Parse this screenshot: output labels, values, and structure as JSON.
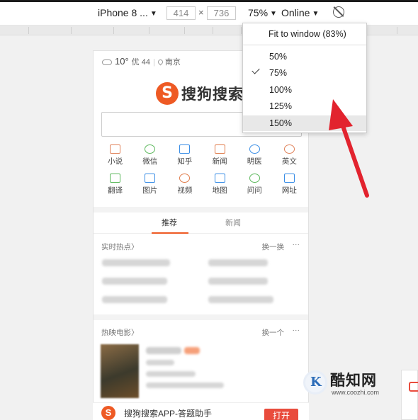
{
  "toolbar": {
    "device": "iPhone 8 ...",
    "width": "414",
    "times": "×",
    "height": "736",
    "zoom": "75%",
    "network": "Online"
  },
  "zoom_menu": {
    "fit_label": "Fit to window (83%)",
    "options": [
      "50%",
      "75%",
      "100%",
      "125%",
      "150%"
    ],
    "selected": "75%",
    "hovered": "150%"
  },
  "page": {
    "weather": {
      "temp": "10°",
      "aqi": "优 44",
      "city": "南京"
    },
    "logo_text": "搜狗搜索",
    "quick_links": [
      "小说",
      "微信",
      "知乎",
      "新闻",
      "明医",
      "英文",
      "翻译",
      "图片",
      "视频",
      "地图",
      "问问",
      "网址"
    ],
    "tabs": [
      "推荐",
      "新闻"
    ],
    "hot_section": {
      "title": "实时热点〉",
      "more": "换一换",
      "dots": "···"
    },
    "movie_section": {
      "title": "热映电影〉",
      "more": "换一个",
      "dots": "···"
    },
    "app_banner": {
      "text": "搜狗搜索APP-答题助手",
      "button": "打开"
    }
  },
  "watermark": {
    "title": "酷知网",
    "url": "www.coozhi.com",
    "logo_letter": "K"
  },
  "colors": {
    "brand": "#ee5a24",
    "annotation_arrow": "#e2232e"
  }
}
